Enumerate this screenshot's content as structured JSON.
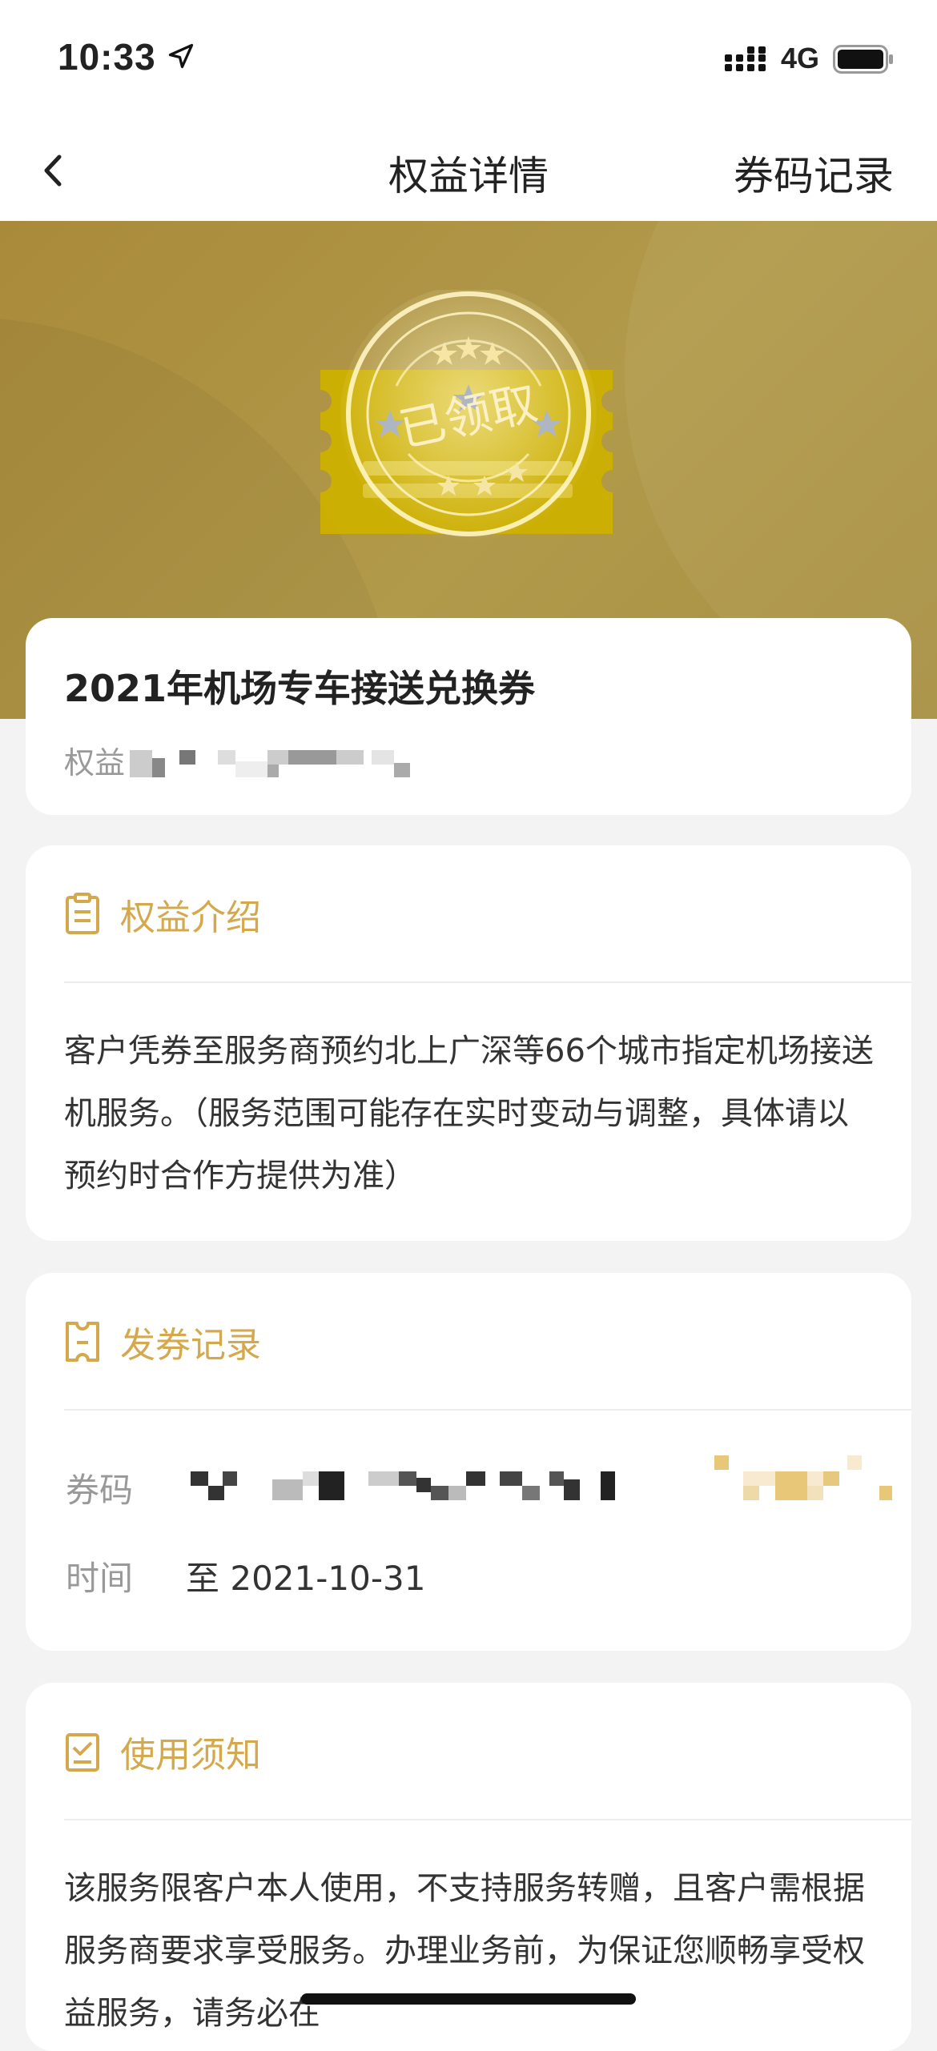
{
  "status": {
    "time": "10:33",
    "network": "4G"
  },
  "nav": {
    "back_icon": "chevron-left-icon",
    "title": "权益详情",
    "right_action": "券码记录"
  },
  "hero": {
    "stamp_text": "已领取",
    "stamp_icon": "coupon-claimed-stamp-icon"
  },
  "benefit": {
    "name": "2021年机场专车接送兑换券",
    "sub_label": "权益"
  },
  "intro": {
    "heading": "权益介绍",
    "icon": "clipboard-icon",
    "text": "客户凭券至服务商预约北上广深等66个城市指定机场接送机服务。（服务范围可能存在实时变动与调整，具体请以预约时合作方提供为准）"
  },
  "issue_record": {
    "heading": "发券记录",
    "icon": "ticket-icon",
    "code_label": "券码",
    "time_label": "时间",
    "time_value": "至 2021-10-31"
  },
  "notice": {
    "heading": "使用须知",
    "icon": "checklist-icon",
    "text": "该服务限客户本人使用，不支持服务转赠，且客户需根据服务商要求享受服务。办理业务前，为保证您顺畅享受权益服务，请务必在"
  },
  "colors": {
    "accent": "#d4a94e",
    "hero": "#b19a4a",
    "background": "#f3f3f3"
  }
}
